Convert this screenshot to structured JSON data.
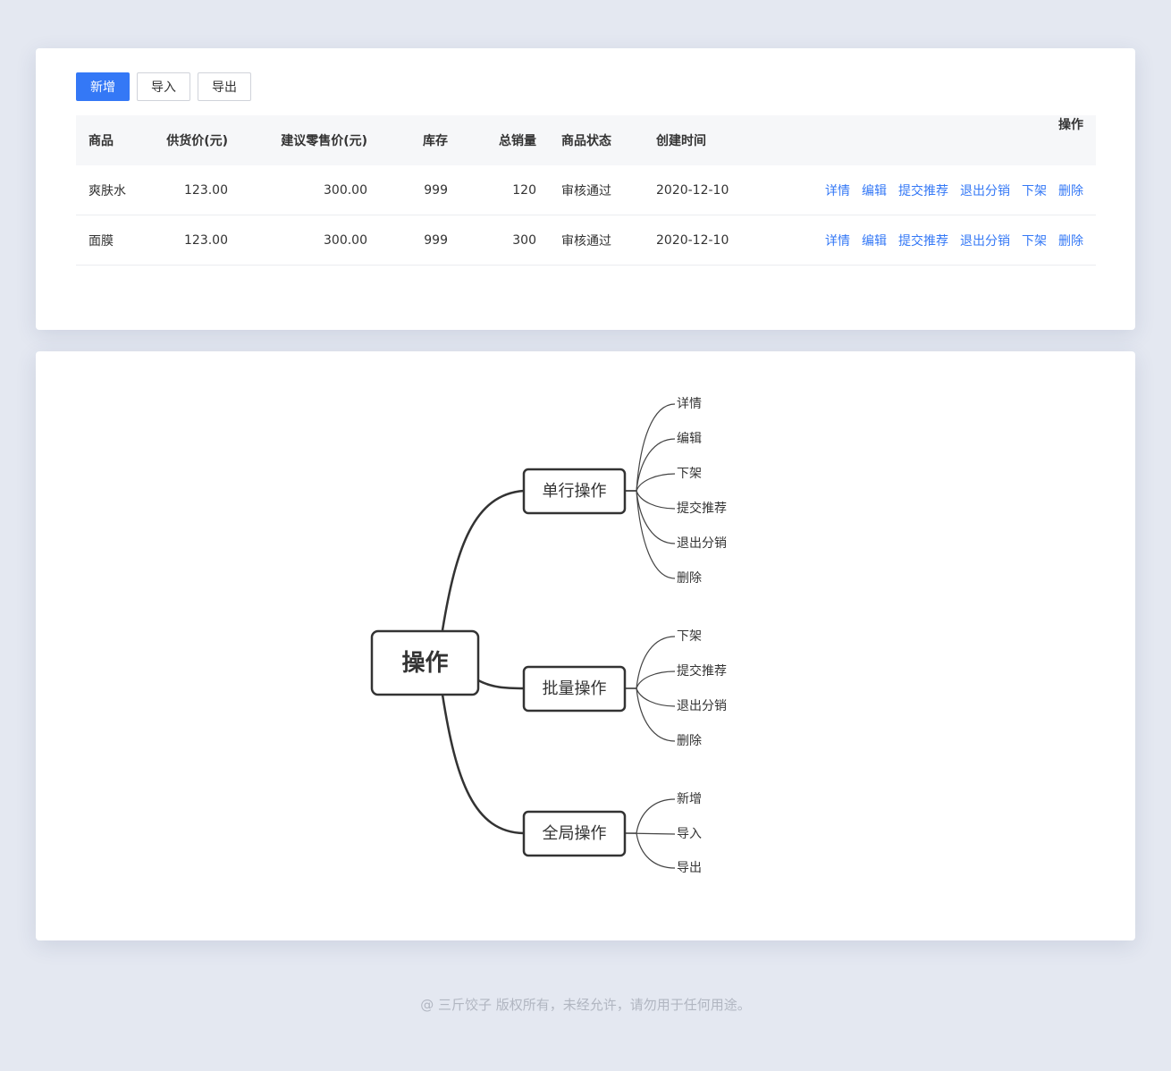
{
  "toolbar": {
    "add_label": "新增",
    "import_label": "导入",
    "export_label": "导出"
  },
  "table": {
    "columns": [
      "商品",
      "供货价(元)",
      "建议零售价(元)",
      "库存",
      "总销量",
      "商品状态",
      "创建时间",
      "操作"
    ],
    "rows": [
      {
        "name": "爽肤水",
        "supply_price": "123.00",
        "retail_price": "300.00",
        "stock": "999",
        "sales": "120",
        "status": "审核通过",
        "created": "2020-12-10",
        "actions": [
          "详情",
          "编辑",
          "提交推荐",
          "退出分销",
          "下架",
          "删除"
        ]
      },
      {
        "name": "面膜",
        "supply_price": "123.00",
        "retail_price": "300.00",
        "stock": "999",
        "sales": "300",
        "status": "审核通过",
        "created": "2020-12-10",
        "actions": [
          "详情",
          "编辑",
          "提交推荐",
          "退出分销",
          "下架",
          "删除"
        ]
      }
    ]
  },
  "mindmap": {
    "root": "操作",
    "branches": [
      {
        "label": "单行操作",
        "children": [
          "详情",
          "编辑",
          "下架",
          "提交推荐",
          "退出分销",
          "删除"
        ]
      },
      {
        "label": "批量操作",
        "children": [
          "下架",
          "提交推荐",
          "退出分销",
          "删除"
        ]
      },
      {
        "label": "全局操作",
        "children": [
          "新增",
          "导入",
          "导出"
        ]
      }
    ]
  },
  "footer": "@ 三斤饺子  版权所有，未经允许，请勿用于任何用途。",
  "colors": {
    "primary": "#3478f6",
    "background": "#e4e8f1",
    "text": "#333333"
  }
}
